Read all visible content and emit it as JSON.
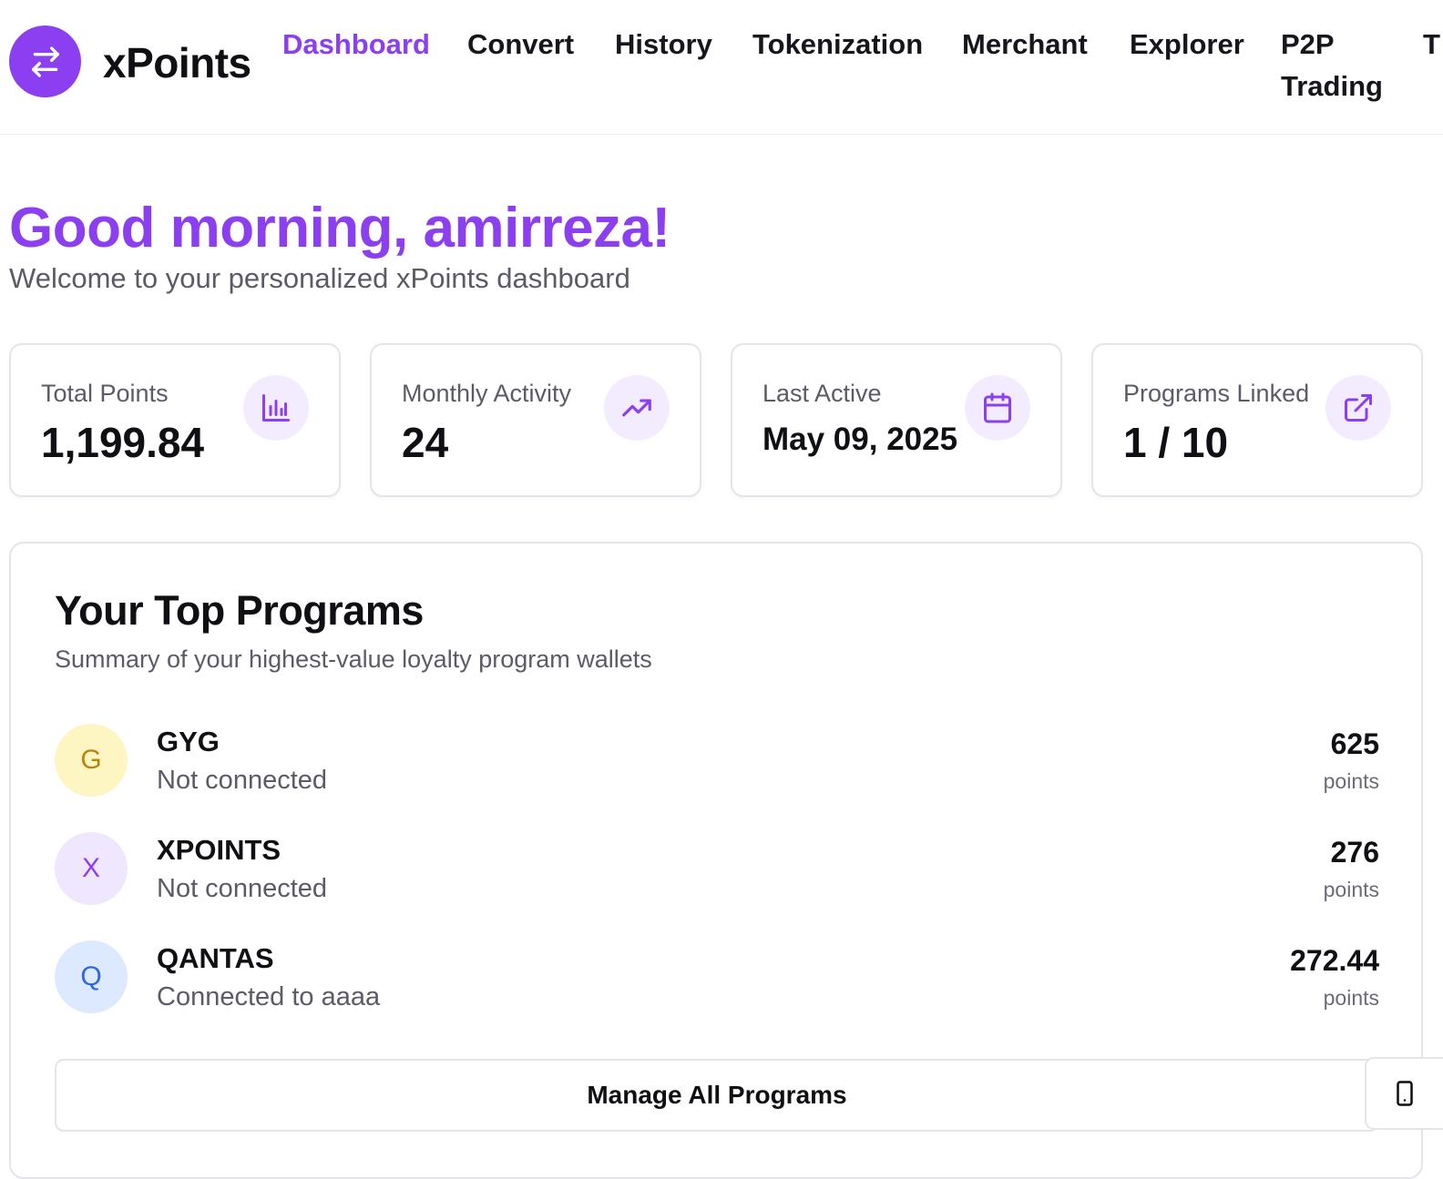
{
  "brand": {
    "name": "xPoints",
    "accent": "#8b3ff0",
    "logo_icon": "swap-arrows-icon"
  },
  "nav": {
    "items": [
      {
        "label": "Dashboard",
        "active": true
      },
      {
        "label": "Convert"
      },
      {
        "label": "History"
      },
      {
        "label": "Tokenization"
      },
      {
        "label": "Merchant"
      },
      {
        "label": "Explorer"
      },
      {
        "label": "P2P Trading"
      }
    ],
    "overflow_label": "T"
  },
  "greeting": {
    "title": "Good morning, amirreza!",
    "subtitle": "Welcome to your personalized xPoints dashboard"
  },
  "stats": [
    {
      "label": "Total Points",
      "value": "1,199.84",
      "icon": "bar-chart-icon"
    },
    {
      "label": "Monthly Activity",
      "value": "24",
      "icon": "trending-up-icon"
    },
    {
      "label": "Last Active",
      "value": "May 09, 2025",
      "icon": "calendar-icon"
    },
    {
      "label": "Programs Linked",
      "value": "1 / 10",
      "icon": "external-link-icon"
    }
  ],
  "top_programs": {
    "title": "Your Top Programs",
    "subtitle": "Summary of your highest-value loyalty program wallets",
    "programs": [
      {
        "initial": "G",
        "name": "GYG",
        "status": "Not connected",
        "points": "625",
        "unit": "points",
        "avatar_bg": "#fdf6c3",
        "avatar_fg": "#b7860b"
      },
      {
        "initial": "X",
        "name": "XPOINTS",
        "status": "Not connected",
        "points": "276",
        "unit": "points",
        "avatar_bg": "#efe7fd",
        "avatar_fg": "#8b3ff0"
      },
      {
        "initial": "Q",
        "name": "QANTAS",
        "status": "Connected to aaaa",
        "points": "272.44",
        "unit": "points",
        "avatar_bg": "#dde9fe",
        "avatar_fg": "#2f66e0"
      }
    ],
    "manage_button": "Manage All Programs",
    "mobile_icon": "smartphone-icon"
  }
}
